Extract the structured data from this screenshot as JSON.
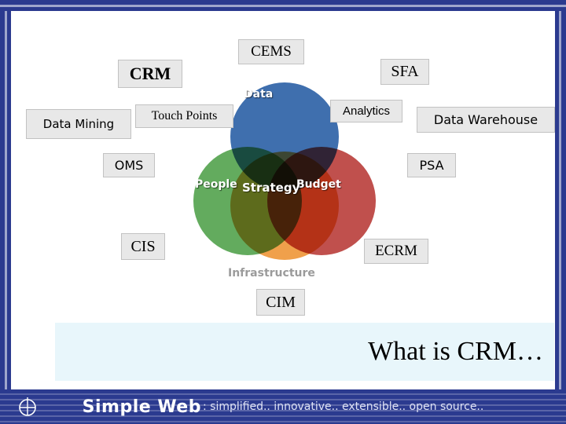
{
  "slide": {
    "venn": {
      "circles": [
        {
          "label": "Data",
          "color": "#3f6fae"
        },
        {
          "label": "People",
          "color": "#63ab5e"
        },
        {
          "label": "Budget",
          "color": "#c0504d"
        },
        {
          "label": "Infrastructure",
          "color": "#f0a04b"
        }
      ],
      "center_label": "Strategy"
    },
    "callouts": [
      {
        "id": "cems",
        "label": "CEMS"
      },
      {
        "id": "crm",
        "label": "CRM"
      },
      {
        "id": "sfa",
        "label": "SFA"
      },
      {
        "id": "analytics",
        "label": "Analytics"
      },
      {
        "id": "touch_points",
        "label": "Touch Points"
      },
      {
        "id": "data_mining",
        "label": "Data Mining"
      },
      {
        "id": "data_warehouse",
        "label": "Data Warehouse"
      },
      {
        "id": "oms",
        "label": "OMS"
      },
      {
        "id": "psa",
        "label": "PSA"
      },
      {
        "id": "cis",
        "label": "CIS"
      },
      {
        "id": "ecrm",
        "label": "ECRM"
      },
      {
        "id": "cim",
        "label": "CIM"
      }
    ],
    "caption": "What is CRM…"
  },
  "footer": {
    "brand": "Simple Web",
    "tagline": ": simplified.. innovative.. extensible.. open source..",
    "logo_icon": "globe-icon"
  },
  "colors": {
    "frame": "#2b3a8f",
    "caption_panel": "#e8f6fb",
    "callout_bg": "#e8e8e8"
  }
}
